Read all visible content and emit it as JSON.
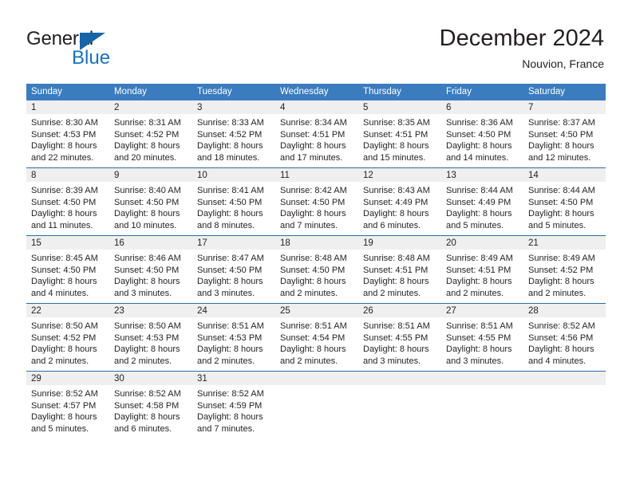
{
  "brand": {
    "name_top": "General",
    "name_bottom": "Blue",
    "accent_color": "#1573bf",
    "triangle_color": "#1565a8"
  },
  "header": {
    "title": "December 2024",
    "subtitle": "Nouvion, France"
  },
  "calendar": {
    "header_bg": "#3a7cbe",
    "header_text_color": "#ffffff",
    "row_divider_color": "#2e6da4",
    "daynum_band_color": "#efefef",
    "weekday_headers": [
      "Sunday",
      "Monday",
      "Tuesday",
      "Wednesday",
      "Thursday",
      "Friday",
      "Saturday"
    ],
    "weeks": [
      [
        {
          "day": "1",
          "sunrise": "Sunrise: 8:30 AM",
          "sunset": "Sunset: 4:53 PM",
          "daylight_line1": "Daylight: 8 hours",
          "daylight_line2": "and 22 minutes."
        },
        {
          "day": "2",
          "sunrise": "Sunrise: 8:31 AM",
          "sunset": "Sunset: 4:52 PM",
          "daylight_line1": "Daylight: 8 hours",
          "daylight_line2": "and 20 minutes."
        },
        {
          "day": "3",
          "sunrise": "Sunrise: 8:33 AM",
          "sunset": "Sunset: 4:52 PM",
          "daylight_line1": "Daylight: 8 hours",
          "daylight_line2": "and 18 minutes."
        },
        {
          "day": "4",
          "sunrise": "Sunrise: 8:34 AM",
          "sunset": "Sunset: 4:51 PM",
          "daylight_line1": "Daylight: 8 hours",
          "daylight_line2": "and 17 minutes."
        },
        {
          "day": "5",
          "sunrise": "Sunrise: 8:35 AM",
          "sunset": "Sunset: 4:51 PM",
          "daylight_line1": "Daylight: 8 hours",
          "daylight_line2": "and 15 minutes."
        },
        {
          "day": "6",
          "sunrise": "Sunrise: 8:36 AM",
          "sunset": "Sunset: 4:50 PM",
          "daylight_line1": "Daylight: 8 hours",
          "daylight_line2": "and 14 minutes."
        },
        {
          "day": "7",
          "sunrise": "Sunrise: 8:37 AM",
          "sunset": "Sunset: 4:50 PM",
          "daylight_line1": "Daylight: 8 hours",
          "daylight_line2": "and 12 minutes."
        }
      ],
      [
        {
          "day": "8",
          "sunrise": "Sunrise: 8:39 AM",
          "sunset": "Sunset: 4:50 PM",
          "daylight_line1": "Daylight: 8 hours",
          "daylight_line2": "and 11 minutes."
        },
        {
          "day": "9",
          "sunrise": "Sunrise: 8:40 AM",
          "sunset": "Sunset: 4:50 PM",
          "daylight_line1": "Daylight: 8 hours",
          "daylight_line2": "and 10 minutes."
        },
        {
          "day": "10",
          "sunrise": "Sunrise: 8:41 AM",
          "sunset": "Sunset: 4:50 PM",
          "daylight_line1": "Daylight: 8 hours",
          "daylight_line2": "and 8 minutes."
        },
        {
          "day": "11",
          "sunrise": "Sunrise: 8:42 AM",
          "sunset": "Sunset: 4:50 PM",
          "daylight_line1": "Daylight: 8 hours",
          "daylight_line2": "and 7 minutes."
        },
        {
          "day": "12",
          "sunrise": "Sunrise: 8:43 AM",
          "sunset": "Sunset: 4:49 PM",
          "daylight_line1": "Daylight: 8 hours",
          "daylight_line2": "and 6 minutes."
        },
        {
          "day": "13",
          "sunrise": "Sunrise: 8:44 AM",
          "sunset": "Sunset: 4:49 PM",
          "daylight_line1": "Daylight: 8 hours",
          "daylight_line2": "and 5 minutes."
        },
        {
          "day": "14",
          "sunrise": "Sunrise: 8:44 AM",
          "sunset": "Sunset: 4:50 PM",
          "daylight_line1": "Daylight: 8 hours",
          "daylight_line2": "and 5 minutes."
        }
      ],
      [
        {
          "day": "15",
          "sunrise": "Sunrise: 8:45 AM",
          "sunset": "Sunset: 4:50 PM",
          "daylight_line1": "Daylight: 8 hours",
          "daylight_line2": "and 4 minutes."
        },
        {
          "day": "16",
          "sunrise": "Sunrise: 8:46 AM",
          "sunset": "Sunset: 4:50 PM",
          "daylight_line1": "Daylight: 8 hours",
          "daylight_line2": "and 3 minutes."
        },
        {
          "day": "17",
          "sunrise": "Sunrise: 8:47 AM",
          "sunset": "Sunset: 4:50 PM",
          "daylight_line1": "Daylight: 8 hours",
          "daylight_line2": "and 3 minutes."
        },
        {
          "day": "18",
          "sunrise": "Sunrise: 8:48 AM",
          "sunset": "Sunset: 4:50 PM",
          "daylight_line1": "Daylight: 8 hours",
          "daylight_line2": "and 2 minutes."
        },
        {
          "day": "19",
          "sunrise": "Sunrise: 8:48 AM",
          "sunset": "Sunset: 4:51 PM",
          "daylight_line1": "Daylight: 8 hours",
          "daylight_line2": "and 2 minutes."
        },
        {
          "day": "20",
          "sunrise": "Sunrise: 8:49 AM",
          "sunset": "Sunset: 4:51 PM",
          "daylight_line1": "Daylight: 8 hours",
          "daylight_line2": "and 2 minutes."
        },
        {
          "day": "21",
          "sunrise": "Sunrise: 8:49 AM",
          "sunset": "Sunset: 4:52 PM",
          "daylight_line1": "Daylight: 8 hours",
          "daylight_line2": "and 2 minutes."
        }
      ],
      [
        {
          "day": "22",
          "sunrise": "Sunrise: 8:50 AM",
          "sunset": "Sunset: 4:52 PM",
          "daylight_line1": "Daylight: 8 hours",
          "daylight_line2": "and 2 minutes."
        },
        {
          "day": "23",
          "sunrise": "Sunrise: 8:50 AM",
          "sunset": "Sunset: 4:53 PM",
          "daylight_line1": "Daylight: 8 hours",
          "daylight_line2": "and 2 minutes."
        },
        {
          "day": "24",
          "sunrise": "Sunrise: 8:51 AM",
          "sunset": "Sunset: 4:53 PM",
          "daylight_line1": "Daylight: 8 hours",
          "daylight_line2": "and 2 minutes."
        },
        {
          "day": "25",
          "sunrise": "Sunrise: 8:51 AM",
          "sunset": "Sunset: 4:54 PM",
          "daylight_line1": "Daylight: 8 hours",
          "daylight_line2": "and 2 minutes."
        },
        {
          "day": "26",
          "sunrise": "Sunrise: 8:51 AM",
          "sunset": "Sunset: 4:55 PM",
          "daylight_line1": "Daylight: 8 hours",
          "daylight_line2": "and 3 minutes."
        },
        {
          "day": "27",
          "sunrise": "Sunrise: 8:51 AM",
          "sunset": "Sunset: 4:55 PM",
          "daylight_line1": "Daylight: 8 hours",
          "daylight_line2": "and 3 minutes."
        },
        {
          "day": "28",
          "sunrise": "Sunrise: 8:52 AM",
          "sunset": "Sunset: 4:56 PM",
          "daylight_line1": "Daylight: 8 hours",
          "daylight_line2": "and 4 minutes."
        }
      ],
      [
        {
          "day": "29",
          "sunrise": "Sunrise: 8:52 AM",
          "sunset": "Sunset: 4:57 PM",
          "daylight_line1": "Daylight: 8 hours",
          "daylight_line2": "and 5 minutes."
        },
        {
          "day": "30",
          "sunrise": "Sunrise: 8:52 AM",
          "sunset": "Sunset: 4:58 PM",
          "daylight_line1": "Daylight: 8 hours",
          "daylight_line2": "and 6 minutes."
        },
        {
          "day": "31",
          "sunrise": "Sunrise: 8:52 AM",
          "sunset": "Sunset: 4:59 PM",
          "daylight_line1": "Daylight: 8 hours",
          "daylight_line2": "and 7 minutes."
        },
        {
          "day": "",
          "sunrise": "",
          "sunset": "",
          "daylight_line1": "",
          "daylight_line2": ""
        },
        {
          "day": "",
          "sunrise": "",
          "sunset": "",
          "daylight_line1": "",
          "daylight_line2": ""
        },
        {
          "day": "",
          "sunrise": "",
          "sunset": "",
          "daylight_line1": "",
          "daylight_line2": ""
        },
        {
          "day": "",
          "sunrise": "",
          "sunset": "",
          "daylight_line1": "",
          "daylight_line2": ""
        }
      ]
    ]
  }
}
